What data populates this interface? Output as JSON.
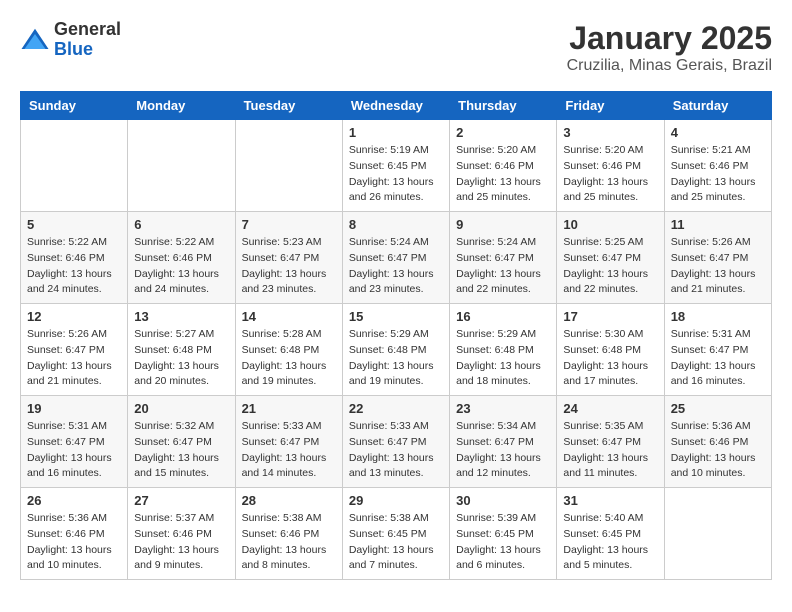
{
  "header": {
    "logo": {
      "general": "General",
      "blue": "Blue"
    },
    "title": "January 2025",
    "subtitle": "Cruzilia, Minas Gerais, Brazil"
  },
  "weekdays": [
    "Sunday",
    "Monday",
    "Tuesday",
    "Wednesday",
    "Thursday",
    "Friday",
    "Saturday"
  ],
  "weeks": [
    [
      {
        "day": "",
        "info": ""
      },
      {
        "day": "",
        "info": ""
      },
      {
        "day": "",
        "info": ""
      },
      {
        "day": "1",
        "info": "Sunrise: 5:19 AM\nSunset: 6:45 PM\nDaylight: 13 hours\nand 26 minutes."
      },
      {
        "day": "2",
        "info": "Sunrise: 5:20 AM\nSunset: 6:46 PM\nDaylight: 13 hours\nand 25 minutes."
      },
      {
        "day": "3",
        "info": "Sunrise: 5:20 AM\nSunset: 6:46 PM\nDaylight: 13 hours\nand 25 minutes."
      },
      {
        "day": "4",
        "info": "Sunrise: 5:21 AM\nSunset: 6:46 PM\nDaylight: 13 hours\nand 25 minutes."
      }
    ],
    [
      {
        "day": "5",
        "info": "Sunrise: 5:22 AM\nSunset: 6:46 PM\nDaylight: 13 hours\nand 24 minutes."
      },
      {
        "day": "6",
        "info": "Sunrise: 5:22 AM\nSunset: 6:46 PM\nDaylight: 13 hours\nand 24 minutes."
      },
      {
        "day": "7",
        "info": "Sunrise: 5:23 AM\nSunset: 6:47 PM\nDaylight: 13 hours\nand 23 minutes."
      },
      {
        "day": "8",
        "info": "Sunrise: 5:24 AM\nSunset: 6:47 PM\nDaylight: 13 hours\nand 23 minutes."
      },
      {
        "day": "9",
        "info": "Sunrise: 5:24 AM\nSunset: 6:47 PM\nDaylight: 13 hours\nand 22 minutes."
      },
      {
        "day": "10",
        "info": "Sunrise: 5:25 AM\nSunset: 6:47 PM\nDaylight: 13 hours\nand 22 minutes."
      },
      {
        "day": "11",
        "info": "Sunrise: 5:26 AM\nSunset: 6:47 PM\nDaylight: 13 hours\nand 21 minutes."
      }
    ],
    [
      {
        "day": "12",
        "info": "Sunrise: 5:26 AM\nSunset: 6:47 PM\nDaylight: 13 hours\nand 21 minutes."
      },
      {
        "day": "13",
        "info": "Sunrise: 5:27 AM\nSunset: 6:48 PM\nDaylight: 13 hours\nand 20 minutes."
      },
      {
        "day": "14",
        "info": "Sunrise: 5:28 AM\nSunset: 6:48 PM\nDaylight: 13 hours\nand 19 minutes."
      },
      {
        "day": "15",
        "info": "Sunrise: 5:29 AM\nSunset: 6:48 PM\nDaylight: 13 hours\nand 19 minutes."
      },
      {
        "day": "16",
        "info": "Sunrise: 5:29 AM\nSunset: 6:48 PM\nDaylight: 13 hours\nand 18 minutes."
      },
      {
        "day": "17",
        "info": "Sunrise: 5:30 AM\nSunset: 6:48 PM\nDaylight: 13 hours\nand 17 minutes."
      },
      {
        "day": "18",
        "info": "Sunrise: 5:31 AM\nSunset: 6:47 PM\nDaylight: 13 hours\nand 16 minutes."
      }
    ],
    [
      {
        "day": "19",
        "info": "Sunrise: 5:31 AM\nSunset: 6:47 PM\nDaylight: 13 hours\nand 16 minutes."
      },
      {
        "day": "20",
        "info": "Sunrise: 5:32 AM\nSunset: 6:47 PM\nDaylight: 13 hours\nand 15 minutes."
      },
      {
        "day": "21",
        "info": "Sunrise: 5:33 AM\nSunset: 6:47 PM\nDaylight: 13 hours\nand 14 minutes."
      },
      {
        "day": "22",
        "info": "Sunrise: 5:33 AM\nSunset: 6:47 PM\nDaylight: 13 hours\nand 13 minutes."
      },
      {
        "day": "23",
        "info": "Sunrise: 5:34 AM\nSunset: 6:47 PM\nDaylight: 13 hours\nand 12 minutes."
      },
      {
        "day": "24",
        "info": "Sunrise: 5:35 AM\nSunset: 6:47 PM\nDaylight: 13 hours\nand 11 minutes."
      },
      {
        "day": "25",
        "info": "Sunrise: 5:36 AM\nSunset: 6:46 PM\nDaylight: 13 hours\nand 10 minutes."
      }
    ],
    [
      {
        "day": "26",
        "info": "Sunrise: 5:36 AM\nSunset: 6:46 PM\nDaylight: 13 hours\nand 10 minutes."
      },
      {
        "day": "27",
        "info": "Sunrise: 5:37 AM\nSunset: 6:46 PM\nDaylight: 13 hours\nand 9 minutes."
      },
      {
        "day": "28",
        "info": "Sunrise: 5:38 AM\nSunset: 6:46 PM\nDaylight: 13 hours\nand 8 minutes."
      },
      {
        "day": "29",
        "info": "Sunrise: 5:38 AM\nSunset: 6:45 PM\nDaylight: 13 hours\nand 7 minutes."
      },
      {
        "day": "30",
        "info": "Sunrise: 5:39 AM\nSunset: 6:45 PM\nDaylight: 13 hours\nand 6 minutes."
      },
      {
        "day": "31",
        "info": "Sunrise: 5:40 AM\nSunset: 6:45 PM\nDaylight: 13 hours\nand 5 minutes."
      },
      {
        "day": "",
        "info": ""
      }
    ]
  ]
}
